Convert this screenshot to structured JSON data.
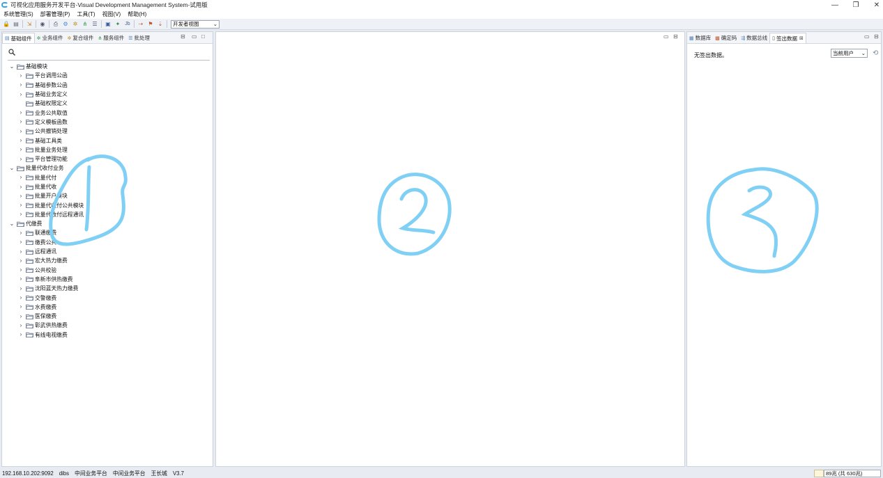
{
  "window": {
    "title": "可视化应用服务开发平台-Visual Development Management System-试用版",
    "controls": [
      "—",
      "❐",
      "✕"
    ]
  },
  "menubar": [
    "系统管理(S)",
    "部署管理(P)",
    "工具(T)",
    "视图(V)",
    "帮助(H)"
  ],
  "toolbar": {
    "view_select": "开发者视图"
  },
  "left_panel": {
    "tabs": [
      "基础组件",
      "业务组件",
      "复合组件",
      "服务组件",
      "批处理"
    ],
    "active_tab": 0,
    "tree": [
      {
        "level": 0,
        "label": "基础模块",
        "expanded": true
      },
      {
        "level": 1,
        "label": "平台调用公函"
      },
      {
        "level": 1,
        "label": "基础参数公函"
      },
      {
        "level": 1,
        "label": "基础业务定义"
      },
      {
        "level": 1,
        "label": "基础权限定义",
        "leaf": true
      },
      {
        "level": 1,
        "label": "业务公共取值"
      },
      {
        "level": 1,
        "label": "定义模板函数"
      },
      {
        "level": 1,
        "label": "公共撤销处理"
      },
      {
        "level": 1,
        "label": "基础工具类"
      },
      {
        "level": 1,
        "label": "批量业务处理"
      },
      {
        "level": 1,
        "label": "平台管理功能"
      },
      {
        "level": 0,
        "label": "批量代收付业务",
        "expanded": true
      },
      {
        "level": 1,
        "label": "批量代付"
      },
      {
        "level": 1,
        "label": "批量代收"
      },
      {
        "level": 1,
        "label": "批量开户模块"
      },
      {
        "level": 1,
        "label": "批量代收付公共模块"
      },
      {
        "level": 1,
        "label": "批量代收付远程通讯"
      },
      {
        "level": 0,
        "label": "代缴费",
        "expanded": true
      },
      {
        "level": 1,
        "label": "联通缴费"
      },
      {
        "level": 1,
        "label": "缴费公共"
      },
      {
        "level": 1,
        "label": "远程通讯"
      },
      {
        "level": 1,
        "label": "宏大热力缴费"
      },
      {
        "level": 1,
        "label": "公共校验"
      },
      {
        "level": 1,
        "label": "阜新市供热缴费"
      },
      {
        "level": 1,
        "label": "沈阳蓝天热力缴费"
      },
      {
        "level": 1,
        "label": "交警缴费"
      },
      {
        "level": 1,
        "label": "水费缴费"
      },
      {
        "level": 1,
        "label": "医保缴费"
      },
      {
        "level": 1,
        "label": "彰武供热缴费"
      },
      {
        "level": 1,
        "label": "有线电视缴费"
      }
    ]
  },
  "right_panel": {
    "tabs": [
      "数据库",
      "确定码",
      "数据总线",
      "签出数据"
    ],
    "active_tab": 3,
    "message": "无签出数据。",
    "user_select": "当前用户"
  },
  "statusbar": {
    "items": [
      "192.168.10.202:9092",
      "dibs",
      "中间业务平台",
      "中间业务平台",
      "王长城",
      "V3.7"
    ],
    "memory": "89兆 (共 630兆)"
  },
  "annotations": [
    "1",
    "2",
    "3"
  ],
  "colors": {
    "annotation": "#7fd0f4",
    "accent": "#35a3e0"
  }
}
